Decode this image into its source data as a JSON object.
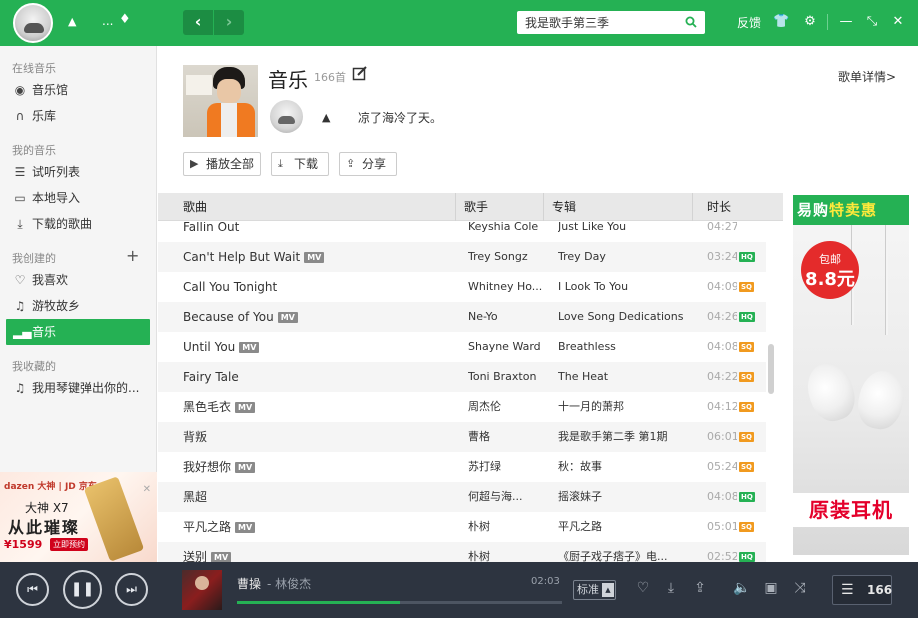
{
  "topbar": {
    "search_value": "我是歌手第三季",
    "feedback": "反馈",
    "dots": "...",
    "back": "‹",
    "forward": "›"
  },
  "sidebar": {
    "sections": [
      {
        "title": "在线音乐",
        "items": [
          {
            "label": "音乐馆",
            "icon": "disc-icon"
          },
          {
            "label": "乐库",
            "icon": "headphones-icon"
          }
        ]
      },
      {
        "title": "我的音乐",
        "items": [
          {
            "label": "试听列表",
            "icon": "list-icon"
          },
          {
            "label": "本地导入",
            "icon": "monitor-icon"
          },
          {
            "label": "下载的歌曲",
            "icon": "download-icon"
          }
        ]
      },
      {
        "title": "我创建的",
        "items": [
          {
            "label": "我喜欢",
            "icon": "heart-icon"
          },
          {
            "label": "游牧故乡",
            "icon": "music-note-icon"
          },
          {
            "label": "音乐",
            "icon": "bars-icon",
            "active": true
          }
        ]
      },
      {
        "title": "我收藏的",
        "items": [
          {
            "label": "我用琴键弹出你的...",
            "icon": "music-note-icon"
          }
        ]
      }
    ],
    "ad": {
      "brand": "dazen 大神 | JD 京东",
      "line1": "大神 X7",
      "line2": "从此璀璨",
      "price": "¥1599",
      "cta": "立即预约"
    }
  },
  "playlist": {
    "title": "音乐",
    "count": "166首",
    "description": "凉了海冷了天。",
    "details_link": "歌单详情>",
    "buttons": {
      "play_all": "播放全部",
      "download": "下载",
      "share": "分享"
    }
  },
  "table": {
    "headers": {
      "title": "歌曲",
      "artist": "歌手",
      "album": "专辑",
      "duration": "时长"
    },
    "rows": [
      {
        "title": "Fallin Out",
        "mv": false,
        "artist": "Keyshia Cole",
        "album": "Just Like You",
        "duration": "04:27",
        "quality": ""
      },
      {
        "title": "Can't Help But Wait",
        "mv": true,
        "artist": "Trey Songz",
        "album": "Trey Day",
        "duration": "03:24",
        "quality": "HQ"
      },
      {
        "title": "Call You Tonight",
        "mv": false,
        "artist": "Whitney Ho...",
        "album": "I Look To You",
        "duration": "04:09",
        "quality": "SQ"
      },
      {
        "title": "Because of You",
        "mv": true,
        "artist": "Ne-Yo",
        "album": "Love Song Dedications",
        "duration": "04:26",
        "quality": "HQ"
      },
      {
        "title": "Until You",
        "mv": true,
        "artist": "Shayne Ward",
        "album": "Breathless",
        "duration": "04:08",
        "quality": "SQ"
      },
      {
        "title": "Fairy Tale",
        "mv": false,
        "artist": "Toni Braxton",
        "album": "The Heat",
        "duration": "04:22",
        "quality": "SQ"
      },
      {
        "title": "黑色毛衣",
        "mv": true,
        "artist": "周杰伦",
        "album": "十一月的萧邦",
        "duration": "04:12",
        "quality": "SQ"
      },
      {
        "title": "背叛",
        "mv": false,
        "artist": "曹格",
        "album": "我是歌手第二季 第1期",
        "duration": "06:01",
        "quality": "SQ"
      },
      {
        "title": "我好想你",
        "mv": true,
        "artist": "苏打绿",
        "album": "秋：故事",
        "duration": "05:24",
        "quality": "SQ"
      },
      {
        "title": "黑超",
        "mv": false,
        "artist": "何超与海...",
        "album": "摇滚妹子",
        "duration": "04:08",
        "quality": "HQ"
      },
      {
        "title": "平凡之路",
        "mv": true,
        "artist": "朴树",
        "album": "平凡之路",
        "duration": "05:01",
        "quality": "SQ"
      },
      {
        "title": "送别",
        "mv": true,
        "artist": "朴树",
        "album": "《厨子戏子痞子》电...",
        "duration": "02:52",
        "quality": "HQ"
      }
    ]
  },
  "right_ad": {
    "header_brand": "易购",
    "header_hot": "特卖惠",
    "badge_top": "包邮",
    "badge_price": "8.8元",
    "footer": "原装耳机"
  },
  "player": {
    "title": "曹操",
    "separator": "-",
    "artist": "林俊杰",
    "time": "02:03",
    "progress": 0.5,
    "quality": "标准",
    "queue_count": "166"
  },
  "colors": {
    "accent": "#25b154",
    "player_bg": "#2d3440",
    "sq": "#f19a1f"
  }
}
